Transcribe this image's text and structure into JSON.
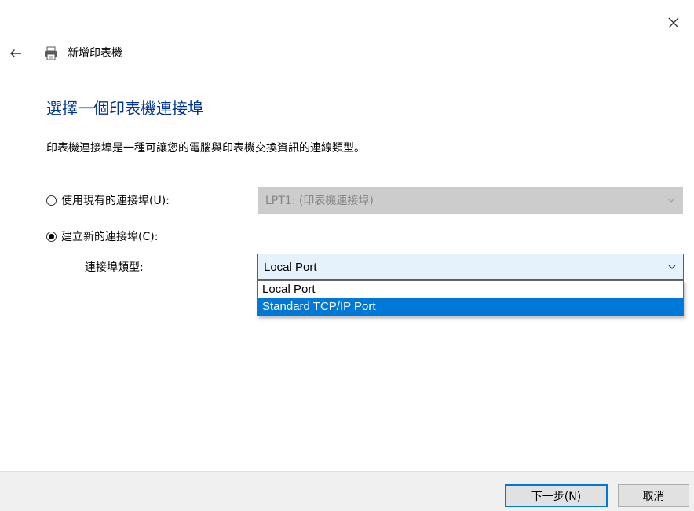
{
  "window": {
    "title": "新增印表機"
  },
  "icons": {
    "close": "close-icon",
    "back": "back-arrow-icon",
    "printer": "printer-icon",
    "chevron": "chevron-down-icon"
  },
  "colors": {
    "heading": "#003399",
    "accent": "#0078d7",
    "disabled_field": "#cccccc",
    "disabled_text": "#838383",
    "footer_bg": "#f0f0f0"
  },
  "content": {
    "heading": "選擇一個印表機連接埠",
    "description": "印表機連接埠是一種可讓您的電腦與印表機交換資訊的連線類型。"
  },
  "options": {
    "use_existing": {
      "label": "使用現有的連接埠(U):",
      "selected": false,
      "select_value": "LPT1: (印表機連接埠)",
      "enabled": false
    },
    "create_new": {
      "label": "建立新的連接埠(C):",
      "selected": true,
      "type_label": "連接埠類型:",
      "select_value": "Local Port",
      "dropdown_open": true,
      "dropdown_options": [
        "Local Port",
        "Standard TCP/IP Port"
      ],
      "highlighted_option": "Standard TCP/IP Port"
    }
  },
  "footer": {
    "next_label": "下一步(N)",
    "cancel_label": "取消"
  }
}
